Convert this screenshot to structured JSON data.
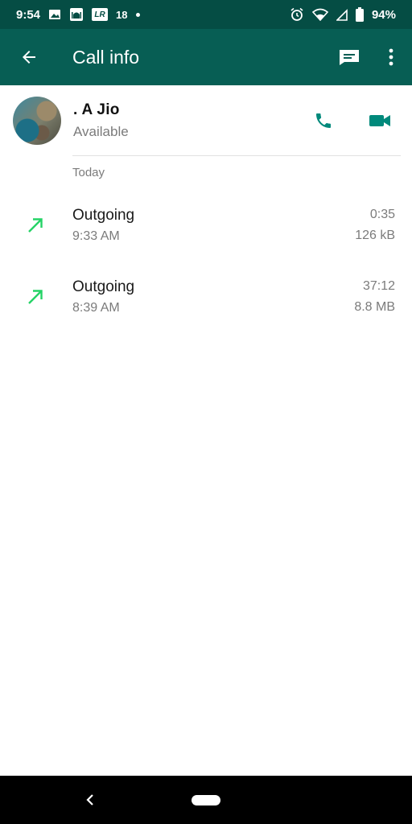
{
  "status_bar": {
    "time": "9:54",
    "badge_number": "18",
    "battery": "94%",
    "icons": [
      "image-icon",
      "mosque-icon",
      "lightroom-icon",
      "alarm-icon",
      "wifi-icon",
      "signal-icon",
      "battery-icon"
    ]
  },
  "app_bar": {
    "title": "Call info"
  },
  "contact": {
    "name": ". A Jio",
    "status": "Available"
  },
  "section": {
    "label": "Today"
  },
  "calls": [
    {
      "type": "Outgoing",
      "time": "9:33 AM",
      "duration": "0:35",
      "size": "126 kB"
    },
    {
      "type": "Outgoing",
      "time": "8:39 AM",
      "duration": "37:12",
      "size": "8.8 MB"
    }
  ],
  "colors": {
    "status_bar": "#054d44",
    "app_bar": "#075e54",
    "accent": "#00897b",
    "outgoing_arrow": "#25d366"
  }
}
